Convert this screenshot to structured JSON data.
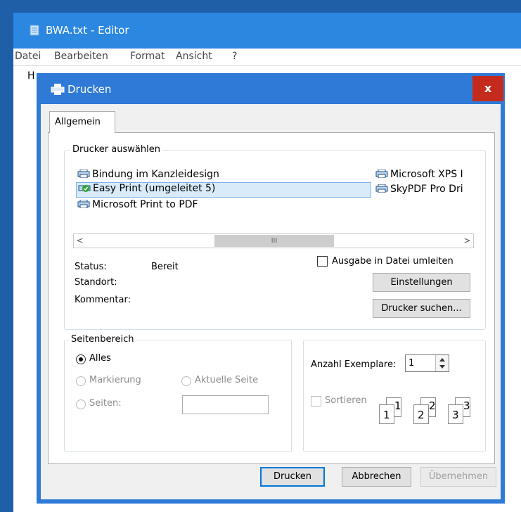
{
  "notepad": {
    "title": "BWA.txt - Editor",
    "menu": [
      "Datei",
      "Bearbeiten",
      "Format",
      "Ansicht",
      "?"
    ],
    "text_visible": "H"
  },
  "dialog": {
    "title": "Drucken",
    "close_label": "x",
    "tab_label": "Allgemein",
    "printer_group_label": "Drucker auswählen",
    "printers": [
      {
        "name": "Bindung im Kanzleidesign",
        "selected": false
      },
      {
        "name": "Easy Print (umgeleitet 5)",
        "selected": true,
        "default": true
      },
      {
        "name": "Microsoft Print to PDF",
        "selected": false
      },
      {
        "name": "Microsoft XPS I",
        "selected": false
      },
      {
        "name": "SkyPDF Pro Dri",
        "selected": false
      }
    ],
    "scroll_thumb_glyph": "III",
    "status_label": "Status:",
    "status_value": "Bereit",
    "location_label": "Standort:",
    "comment_label": "Kommentar:",
    "print_to_file_label": "Ausgabe in Datei umleiten",
    "settings_button": "Einstellungen",
    "find_printer_button": "Drucker suchen...",
    "page_range_label": "Seitenbereich",
    "range_all": "Alles",
    "range_selection": "Markierung",
    "range_current": "Aktuelle Seite",
    "range_pages": "Seiten:",
    "copies_label": "Anzahl Exemplare:",
    "copies_value": "1",
    "collate_label": "Sortieren",
    "collate_pages": [
      "1",
      "1",
      "2",
      "2",
      "3",
      "3"
    ],
    "print_button": "Drucken",
    "cancel_button": "Abbrechen",
    "apply_button": "Übernehmen"
  },
  "colors": {
    "title_blue": "#2f7ad6",
    "close_red": "#c42b1c",
    "selection": "#d9ebf9"
  }
}
